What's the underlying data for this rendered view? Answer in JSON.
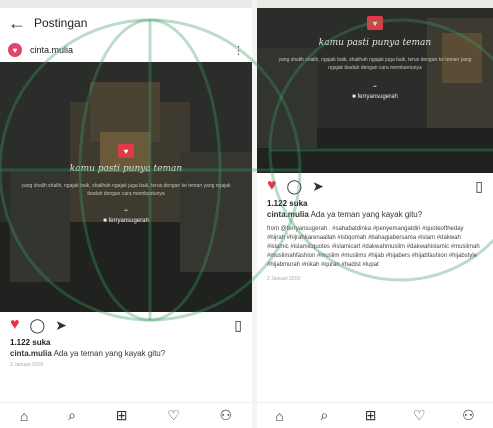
{
  "left": {
    "header_title": "Postingan",
    "username": "cinta.mulia",
    "post": {
      "quote": "kamu pasti punya teman",
      "body": "yang shalih shalih, ngajak baik, shalihah ngajak juga baik, terus dengan ke teman yang ngajak ibadah dengan cara membantunya",
      "marks": "••",
      "handle": "■ ferryansugerah"
    },
    "likes": "1.122 suka",
    "caption_user": "cinta.mulia",
    "caption_text": "Ada ya teman yang kayak gitu?",
    "meta": "2 Januari 2019"
  },
  "right": {
    "post": {
      "quote": "kamu pasti punya teman",
      "body": "yang shalih shalih, ngajak baik, shalihah ngajak juga baik, terus dengan ke teman yang ngajak ibadah dengan cara membantunya",
      "marks": "••",
      "handle": "■ ferryansugerah"
    },
    "likes": "1.122 suka",
    "caption_user": "cinta.mulia",
    "caption_text": "Ada ya teman yang kayak gitu?",
    "comments": "from @ferryansugerah . #sahabatdinka #penyemangatdiri #quoteoftheday #hijrah #hijrahkarenaallah #istiqomah #bahagiabersama #islam #dakwah #islamic #islamicquotes #islamicart #dakwahmuslim #dakwahislamic #muslimah #muslimahfashion #muslim #muslims #hijab #hijabers #hijabfashion #hijabstyle #hijabmurah #nikah #quran #hadist #lupat",
    "meta": "2 Januari 2019"
  },
  "icons": {
    "back": "back-arrow",
    "menu": "more-dots",
    "like": "heart",
    "comment": "comment-bubble",
    "share": "send-arrow",
    "save": "bookmark",
    "nav": [
      "home",
      "search",
      "add",
      "activity",
      "profile"
    ]
  },
  "colors": {
    "like": "#e8334c",
    "post_bg": "#2c2e2b",
    "watermark": "#3c9b62"
  }
}
